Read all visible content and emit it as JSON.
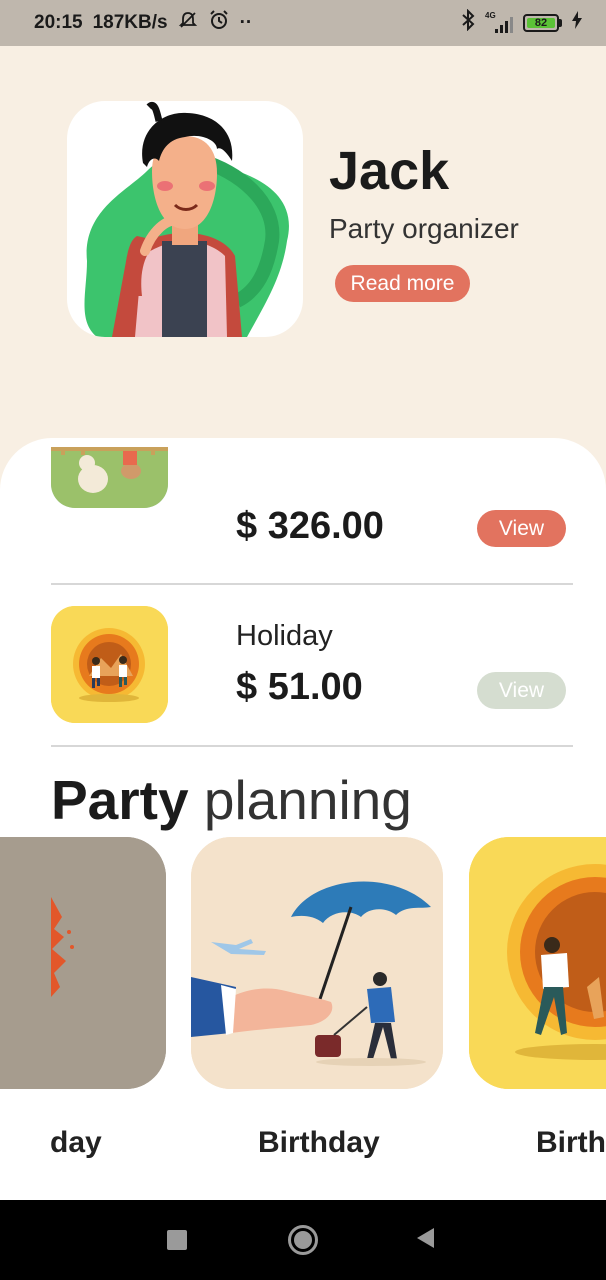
{
  "status_bar": {
    "time": "20:15",
    "speed": "187KB/s",
    "dots": "··",
    "network": "4G",
    "battery": "82"
  },
  "profile": {
    "name": "Jack",
    "role": "Party organizer",
    "read_more_label": "Read more"
  },
  "events": [
    {
      "title": "",
      "price": "$ 326.00",
      "view_label": "View",
      "view_color": "#e2735f"
    },
    {
      "title": "Holiday",
      "price": "$ 51.00",
      "view_label": "View",
      "view_color": "#d5ddd0"
    }
  ],
  "section": {
    "title_bold": "Party",
    "title_light": "planning"
  },
  "carousel": [
    {
      "label": "day"
    },
    {
      "label": "Birthday"
    },
    {
      "label": "Birth"
    }
  ],
  "colors": {
    "background": "#f8efe3",
    "accent": "#e2735f",
    "view_disabled": "#d5ddd0"
  }
}
